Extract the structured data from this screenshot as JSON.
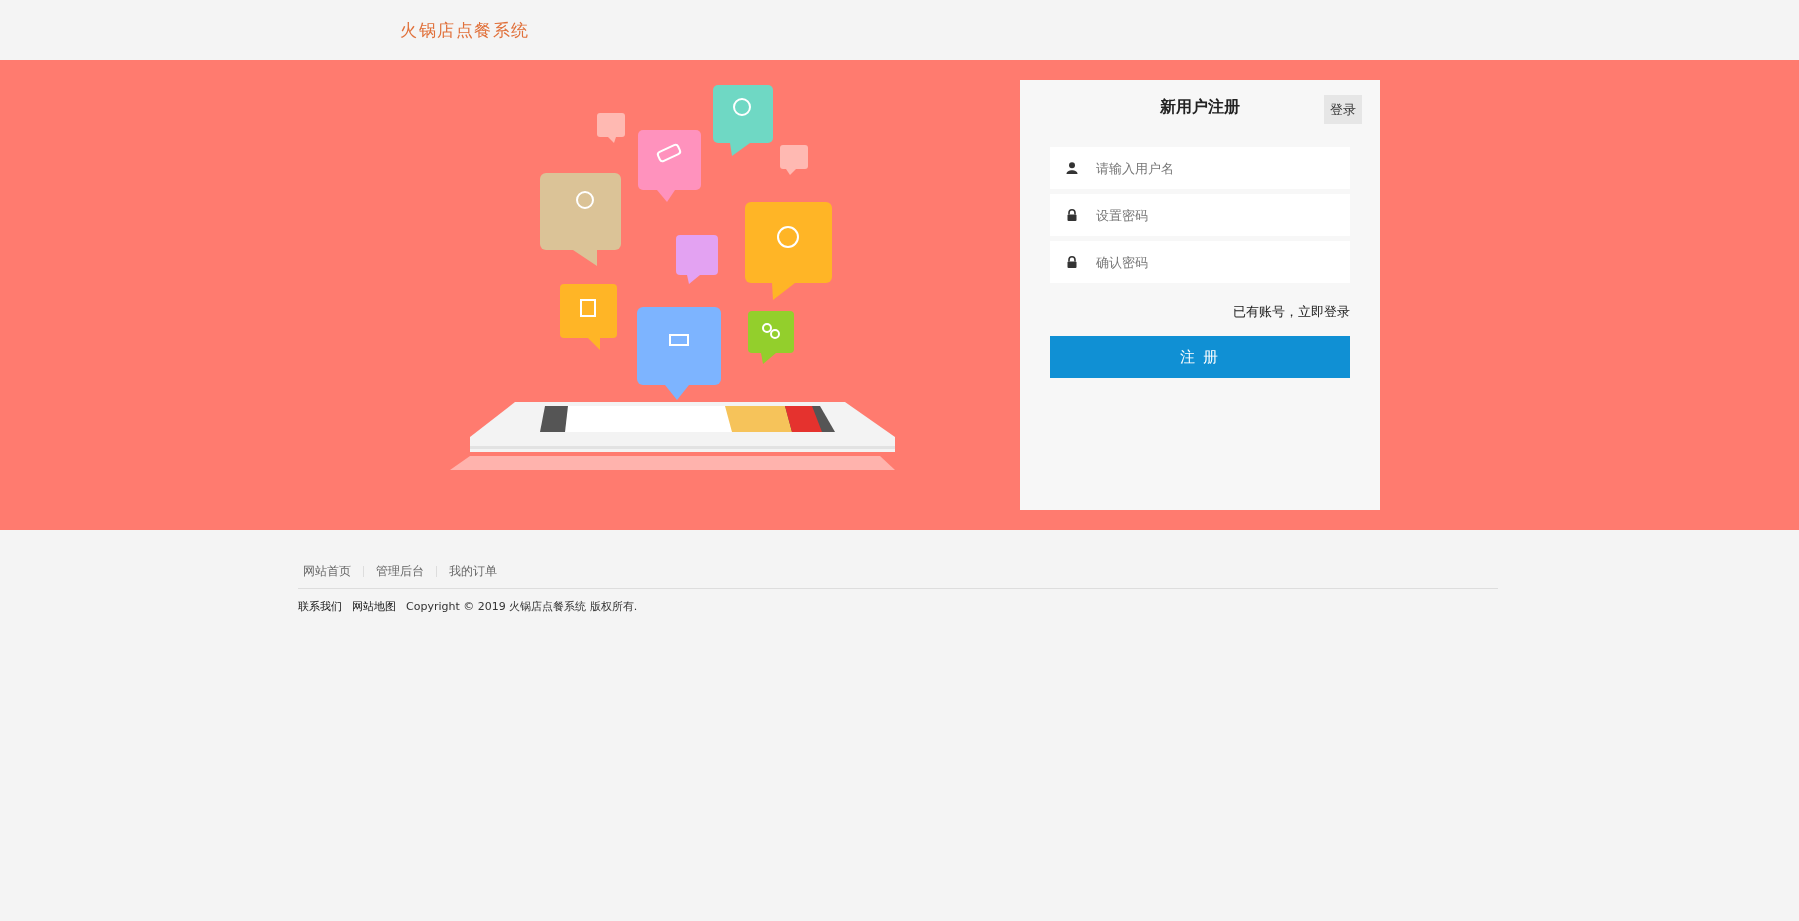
{
  "header": {
    "title": "火锅店点餐系统"
  },
  "register_form": {
    "title": "新用户注册",
    "login_button": "登录",
    "fields": [
      {
        "kind": "user",
        "placeholder": "请输入用户名"
      },
      {
        "kind": "lock",
        "placeholder": "设置密码"
      },
      {
        "kind": "lock",
        "placeholder": "确认密码"
      }
    ],
    "login_link": "已有账号，立即登录",
    "submit_button": "注 册"
  },
  "footer": {
    "nav_links": [
      "网站首页",
      "管理后台",
      "我的订单"
    ],
    "links": [
      "联系我们",
      "网站地图"
    ],
    "copyright": "Copyright © 2019 火锅店点餐系统 版权所有."
  }
}
